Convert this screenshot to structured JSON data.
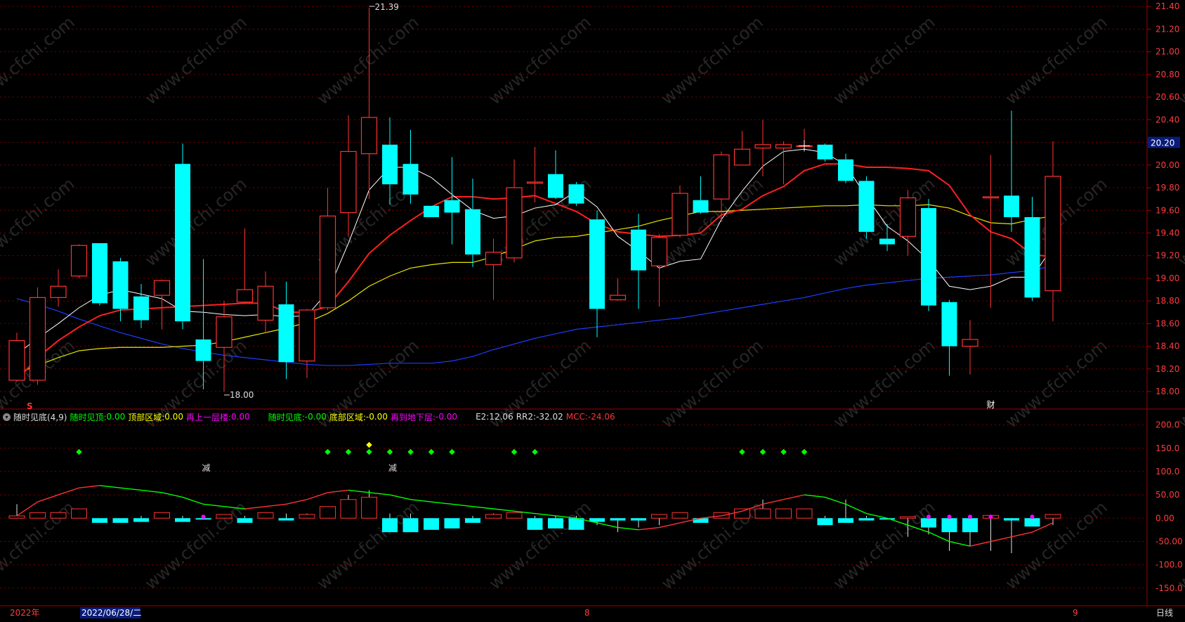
{
  "colors": {
    "up": "#ff3232",
    "down": "#00ffff",
    "ma5": "#ffffff",
    "ma10": "#ff2020",
    "ma20": "#e6e600",
    "ma60": "#1e3cff",
    "grid": "#7a0000",
    "axis_text": "#ff3c3c",
    "osc_up": "#ff3232",
    "osc_down": "#00ff00"
  },
  "price_axis": {
    "ticks": [
      "21.40",
      "21.20",
      "21.00",
      "20.80",
      "20.60",
      "20.40",
      "20.20",
      "20.00",
      "19.80",
      "19.60",
      "19.40",
      "19.20",
      "19.00",
      "18.80",
      "18.60",
      "18.40",
      "18.20",
      "18.00"
    ],
    "current_price": "20.20"
  },
  "osc_axis": {
    "ticks": [
      "200.0",
      "150.0",
      "100.0",
      "50.00",
      "0.00",
      "-50.00",
      "-100.0",
      "-150.0"
    ]
  },
  "annotations": {
    "high": "21.39",
    "low": "18.00",
    "s_marker": "S",
    "cai_marker": "财",
    "jian1": "减",
    "jian2": "减"
  },
  "indicator": {
    "name": "随时见底(4,9)",
    "items": [
      {
        "label": "随时见顶:",
        "value": "0.00",
        "color": "#00ff00"
      },
      {
        "label": "顶部区域:",
        "value": "0.00",
        "color": "#ffff00"
      },
      {
        "label": "再上一层楼:",
        "value": "0.00",
        "color": "#ff00ff"
      },
      {
        "label": "随时见底:",
        "value": "-0.00",
        "color": "#00ff00"
      },
      {
        "label": "底部区域:",
        "value": "-0.00",
        "color": "#ffff00"
      },
      {
        "label": "再到地下层:",
        "value": "-0.00",
        "color": "#ff00ff"
      },
      {
        "label": "E2:",
        "value": "12.06",
        "color": "#dddddd"
      },
      {
        "label": "RR2:",
        "value": "-32.02",
        "color": "#dddddd"
      },
      {
        "label": "MCC:",
        "value": "-24.06",
        "color": "#ff3232"
      }
    ]
  },
  "bottom_bar": {
    "year": "2022年",
    "date": "2022/06/28/二",
    "month8": "8",
    "month9": "9",
    "period": "日线"
  },
  "watermark": "www.cfchi.com",
  "chart_data": {
    "type": "candlestick",
    "ylim": [
      17.92,
      21.42
    ],
    "candles": [
      [
        18.1,
        18.45,
        18.52,
        18.09
      ],
      [
        18.1,
        18.83,
        18.92,
        18.06
      ],
      [
        18.83,
        18.93,
        19.08,
        18.75
      ],
      [
        19.02,
        19.29,
        19.3,
        19.0
      ],
      [
        19.31,
        18.78,
        19.31,
        18.76
      ],
      [
        19.15,
        18.73,
        19.18,
        18.62
      ],
      [
        18.84,
        18.63,
        18.95,
        18.56
      ],
      [
        18.85,
        18.98,
        18.99,
        18.55
      ],
      [
        20.01,
        18.62,
        20.19,
        18.55
      ],
      [
        18.46,
        18.27,
        19.17,
        18.02
      ],
      [
        18.39,
        18.66,
        18.8,
        18.0
      ],
      [
        18.79,
        18.9,
        19.44,
        18.78
      ],
      [
        18.63,
        18.93,
        19.06,
        18.52
      ],
      [
        18.77,
        18.26,
        18.97,
        18.11
      ],
      [
        18.27,
        18.72,
        18.73,
        18.12
      ],
      [
        18.74,
        19.55,
        19.8,
        18.72
      ],
      [
        19.58,
        20.12,
        20.44,
        19.38
      ],
      [
        20.1,
        20.42,
        21.39,
        19.7
      ],
      [
        20.18,
        19.83,
        20.42,
        19.65
      ],
      [
        20.01,
        19.74,
        20.31,
        19.66
      ],
      [
        19.64,
        19.54,
        19.64,
        19.56
      ],
      [
        19.69,
        19.58,
        20.07,
        19.3
      ],
      [
        19.61,
        19.21,
        19.88,
        19.1
      ],
      [
        19.12,
        19.23,
        19.35,
        18.81
      ],
      [
        19.18,
        19.8,
        20.05,
        19.14
      ],
      [
        19.84,
        19.85,
        20.16,
        19.67
      ],
      [
        19.92,
        19.71,
        20.13,
        19.7
      ],
      [
        19.83,
        19.66,
        19.85,
        19.64
      ],
      [
        19.52,
        18.73,
        19.6,
        18.48
      ],
      [
        18.81,
        18.85,
        19.0,
        18.8
      ],
      [
        19.43,
        19.07,
        19.57,
        18.73
      ],
      [
        19.11,
        19.36,
        19.39,
        18.75
      ],
      [
        19.38,
        19.75,
        19.82,
        19.36
      ],
      [
        19.69,
        19.58,
        19.9,
        19.57
      ],
      [
        19.7,
        20.09,
        20.12,
        19.5
      ],
      [
        20.0,
        20.14,
        20.3,
        20.0
      ],
      [
        20.15,
        20.18,
        20.4,
        19.9
      ],
      [
        20.15,
        20.18,
        20.21,
        19.83
      ],
      [
        20.17,
        20.17,
        20.32,
        20.13
      ],
      [
        20.18,
        20.05,
        20.19,
        20.03
      ],
      [
        20.05,
        19.86,
        20.1,
        19.84
      ],
      [
        19.86,
        19.41,
        19.9,
        19.35
      ],
      [
        19.35,
        19.3,
        19.48,
        19.24
      ],
      [
        19.37,
        19.71,
        19.78,
        19.2
      ],
      [
        19.62,
        18.76,
        19.7,
        18.71
      ],
      [
        18.79,
        18.4,
        18.81,
        18.14
      ],
      [
        18.4,
        18.46,
        18.63,
        18.15
      ],
      [
        19.71,
        19.72,
        20.09,
        18.74
      ],
      [
        19.73,
        19.54,
        20.48,
        19.41
      ],
      [
        19.54,
        18.83,
        19.72,
        18.8
      ],
      [
        18.89,
        19.9,
        20.21,
        18.62
      ]
    ],
    "ma5": [
      18.33,
      18.47,
      18.6,
      18.74,
      18.85,
      18.9,
      18.86,
      18.82,
      18.71,
      18.7,
      18.68,
      18.67,
      18.68,
      18.66,
      18.67,
      18.88,
      19.31,
      19.78,
      19.98,
      19.98,
      19.89,
      19.74,
      19.6,
      19.53,
      19.55,
      19.62,
      19.65,
      19.77,
      19.63,
      19.37,
      19.24,
      19.09,
      19.15,
      19.17,
      19.52,
      19.77,
      19.99,
      20.12,
      20.14,
      20.11,
      20.0,
      19.72,
      19.46,
      19.33,
      19.16,
      18.93,
      18.9,
      18.93,
      19.01,
      19.01,
      19.28
    ],
    "ma10": [
      18.1,
      18.3,
      18.45,
      18.57,
      18.67,
      18.72,
      18.73,
      18.74,
      18.75,
      18.76,
      18.77,
      18.78,
      18.78,
      18.7,
      18.7,
      18.75,
      18.97,
      19.22,
      19.38,
      19.51,
      19.63,
      19.72,
      19.72,
      19.7,
      19.71,
      19.73,
      19.66,
      19.59,
      19.48,
      19.41,
      19.39,
      19.37,
      19.38,
      19.4,
      19.56,
      19.61,
      19.73,
      19.81,
      19.95,
      20.01,
      20.01,
      19.98,
      19.98,
      19.97,
      19.95,
      19.82,
      19.56,
      19.41,
      19.35,
      19.21,
      19.19
    ],
    "ma20": [
      18.16,
      18.23,
      18.3,
      18.36,
      18.38,
      18.39,
      18.39,
      18.39,
      18.4,
      18.41,
      18.44,
      18.48,
      18.52,
      18.56,
      18.61,
      18.69,
      18.8,
      18.93,
      19.02,
      19.09,
      19.12,
      19.14,
      19.14,
      19.19,
      19.26,
      19.33,
      19.36,
      19.37,
      19.4,
      19.43,
      19.46,
      19.51,
      19.55,
      19.59,
      19.59,
      19.6,
      19.61,
      19.62,
      19.63,
      19.64,
      19.64,
      19.65,
      19.64,
      19.64,
      19.65,
      19.62,
      19.55,
      19.49,
      19.48,
      19.52,
      19.55
    ],
    "ma60": [
      18.82,
      18.77,
      18.71,
      18.64,
      18.58,
      18.52,
      18.47,
      18.42,
      18.38,
      18.35,
      18.32,
      18.3,
      18.28,
      18.26,
      18.24,
      18.23,
      18.23,
      18.24,
      18.25,
      18.25,
      18.25,
      18.27,
      18.31,
      18.37,
      18.42,
      18.47,
      18.51,
      18.55,
      18.57,
      18.59,
      18.61,
      18.63,
      18.65,
      18.68,
      18.71,
      18.74,
      18.77,
      18.8,
      18.83,
      18.87,
      18.91,
      18.94,
      18.96,
      18.98,
      19.0,
      19.01,
      19.02,
      19.03,
      19.05,
      19.07,
      19.11
    ],
    "osc_ylim": [
      -185,
      225
    ],
    "osc_bars": [
      5,
      12,
      12,
      20,
      -10,
      -10,
      -8,
      12,
      -8,
      -3,
      8,
      -10,
      12,
      -5,
      8,
      25,
      40,
      45,
      -30,
      -30,
      -25,
      -22,
      -10,
      8,
      12,
      -25,
      -22,
      -25,
      -8,
      -5,
      -5,
      8,
      12,
      -10,
      12,
      20,
      20,
      20,
      20,
      -15,
      -10,
      -5,
      -3,
      3,
      -20,
      -30,
      -30,
      6,
      -5,
      -18,
      8
    ],
    "osc_lines": [
      30,
      5,
      10,
      10,
      0,
      0,
      5,
      10,
      5,
      0,
      5,
      5,
      5,
      10,
      10,
      15,
      50,
      60,
      10,
      10,
      0,
      0,
      5,
      10,
      5,
      5,
      5,
      5,
      -15,
      -30,
      -20,
      -15,
      0,
      0,
      0,
      5,
      40,
      20,
      5,
      5,
      40,
      5,
      0,
      -40,
      -35,
      -70,
      -60,
      -70,
      -75,
      -10,
      -15
    ],
    "osc_curve": [
      5,
      35,
      50,
      65,
      70,
      65,
      60,
      55,
      45,
      30,
      25,
      20,
      25,
      30,
      40,
      55,
      60,
      55,
      50,
      40,
      35,
      30,
      25,
      20,
      15,
      10,
      5,
      0,
      -10,
      -20,
      -25,
      -20,
      -10,
      0,
      5,
      15,
      30,
      40,
      50,
      45,
      30,
      10,
      0,
      -15,
      -30,
      -50,
      -60,
      -50,
      -40,
      -30,
      -10
    ],
    "top_dots": [
      3,
      15,
      16,
      17,
      18,
      19,
      20,
      21,
      24,
      25,
      35,
      36,
      37,
      38
    ],
    "magenta_dots": [
      9,
      44,
      45,
      46,
      47,
      49
    ]
  }
}
